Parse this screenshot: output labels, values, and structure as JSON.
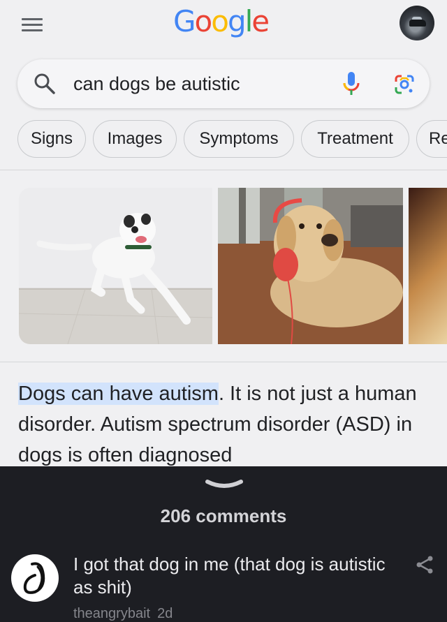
{
  "header": {
    "logo_letters": [
      {
        "ch": "G",
        "color": "#4285F4"
      },
      {
        "ch": "o",
        "color": "#EA4335"
      },
      {
        "ch": "o",
        "color": "#FBBC05"
      },
      {
        "ch": "g",
        "color": "#4285F4"
      },
      {
        "ch": "l",
        "color": "#34A853"
      },
      {
        "ch": "e",
        "color": "#EA4335"
      }
    ]
  },
  "search": {
    "query": "can dogs be autistic"
  },
  "chips": [
    "Signs",
    "Images",
    "Symptoms",
    "Treatment",
    "Re"
  ],
  "snippet": {
    "highlight": "Dogs can have autism",
    "rest": ". It is not just a human disorder. Autism spectrum disorder (ASD) in dogs is often diagnosed"
  },
  "comments": {
    "count_label": "206 comments",
    "items": [
      {
        "text": "I got that dog in me (that dog is autistic as shit)",
        "author": "theangrybait",
        "time": "2d"
      }
    ]
  },
  "colors": {
    "accent_blue": "#1a73e8",
    "highlight": "#d2e3fc",
    "dark_bg": "#1d1e23"
  }
}
